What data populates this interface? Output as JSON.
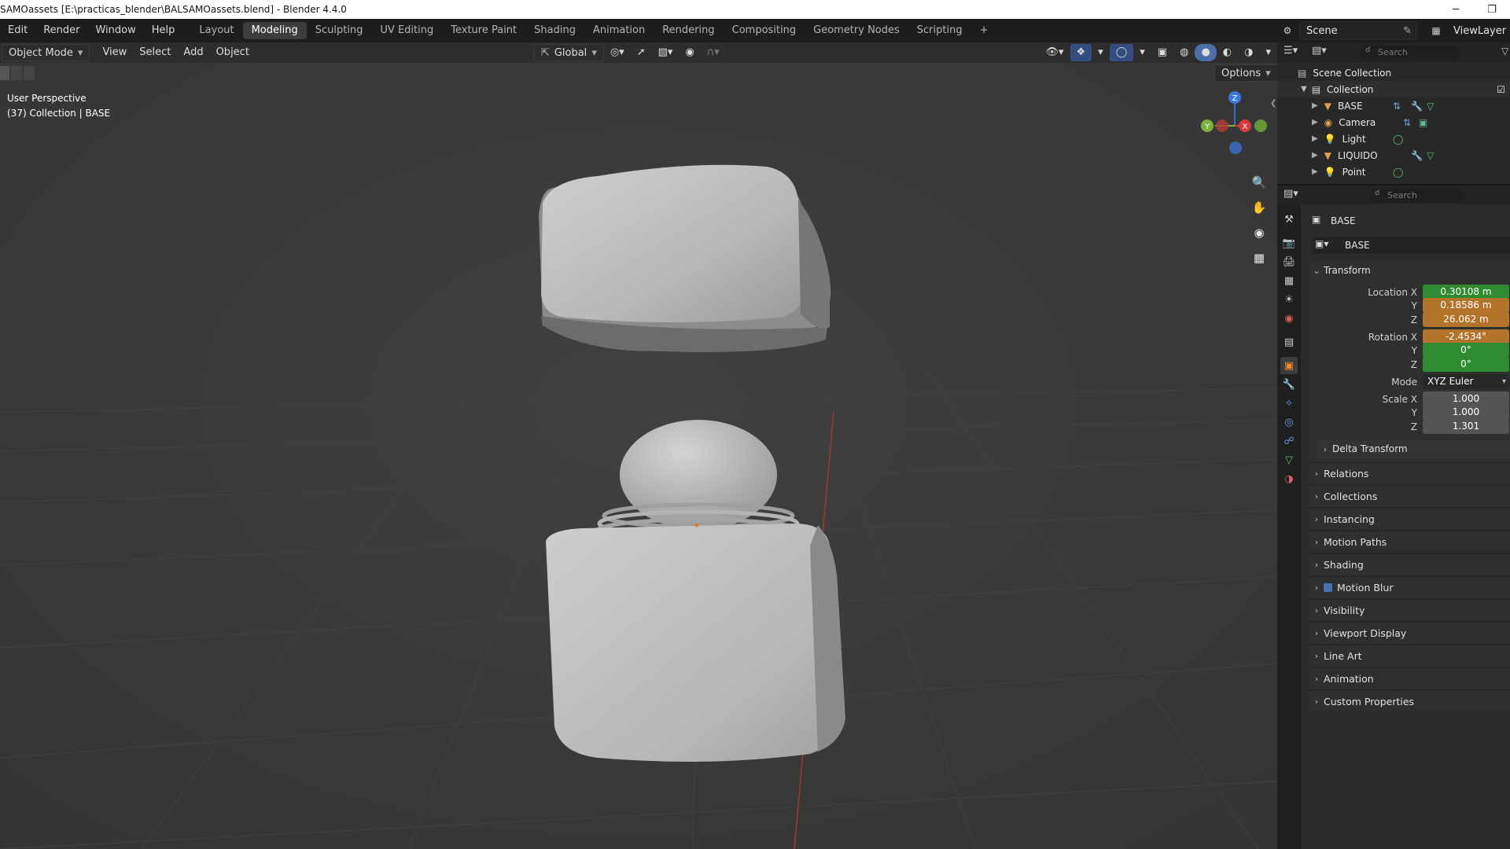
{
  "window": {
    "title": "SAMOassets [E:\\practicas_blender\\BALSAMOassets.blend] - Blender 4.4.0",
    "minimize": "─",
    "restore": "❐"
  },
  "menu": {
    "items": [
      "Edit",
      "Render",
      "Window",
      "Help"
    ]
  },
  "workspaces": [
    "Layout",
    "Modeling",
    "Sculpting",
    "UV Editing",
    "Texture Paint",
    "Shading",
    "Animation",
    "Rendering",
    "Compositing",
    "Geometry Nodes",
    "Scripting",
    "+"
  ],
  "scene": {
    "name": "Scene",
    "view_layer": "ViewLayer"
  },
  "viewport": {
    "mode": "Object Mode",
    "menus": [
      "View",
      "Select",
      "Add",
      "Object"
    ],
    "transform_orientation": "Global",
    "options": "Options",
    "perspective": "User Perspective",
    "collection_info": "(37) Collection | BASE",
    "gizmo": {
      "z": "Z",
      "y": "Y",
      "x": "X"
    }
  },
  "outliner": {
    "search_placeholder": "Search",
    "scene_collection": "Scene Collection",
    "collection": "Collection",
    "objects": [
      {
        "name": "BASE",
        "icon": "mesh-icon"
      },
      {
        "name": "Camera",
        "icon": "camera-icon"
      },
      {
        "name": "Light",
        "icon": "light-icon"
      },
      {
        "name": "LIQUIDO",
        "icon": "mesh-icon"
      },
      {
        "name": "Point",
        "icon": "light-icon"
      }
    ]
  },
  "properties": {
    "search_placeholder": "Search",
    "object_name": "BASE",
    "datablock_name": "BASE",
    "transform_label": "Transform",
    "location": {
      "label_x": "Location X",
      "label_y": "Y",
      "label_z": "Z",
      "x": "0.30108 m",
      "y": "0.18586 m",
      "z": "26.062 m"
    },
    "rotation": {
      "label_x": "Rotation X",
      "label_y": "Y",
      "label_z": "Z",
      "x": "-2.4534°",
      "y": "0°",
      "z": "0°"
    },
    "mode": {
      "label": "Mode",
      "value": "XYZ Euler"
    },
    "scale": {
      "label_x": "Scale X",
      "label_y": "Y",
      "label_z": "Z",
      "x": "1.000",
      "y": "1.000",
      "z": "1.301"
    },
    "delta_transform": "Delta Transform",
    "panels": [
      "Relations",
      "Collections",
      "Instancing",
      "Motion Paths",
      "Shading",
      "Motion Blur",
      "Visibility",
      "Viewport Display",
      "Line Art",
      "Animation",
      "Custom Properties"
    ]
  },
  "colors": {
    "keyed_green": "#2f8b2f",
    "changed_orange": "#b2742a",
    "field_gray": "#545454",
    "viewport_bg": "#3a3a3a"
  }
}
